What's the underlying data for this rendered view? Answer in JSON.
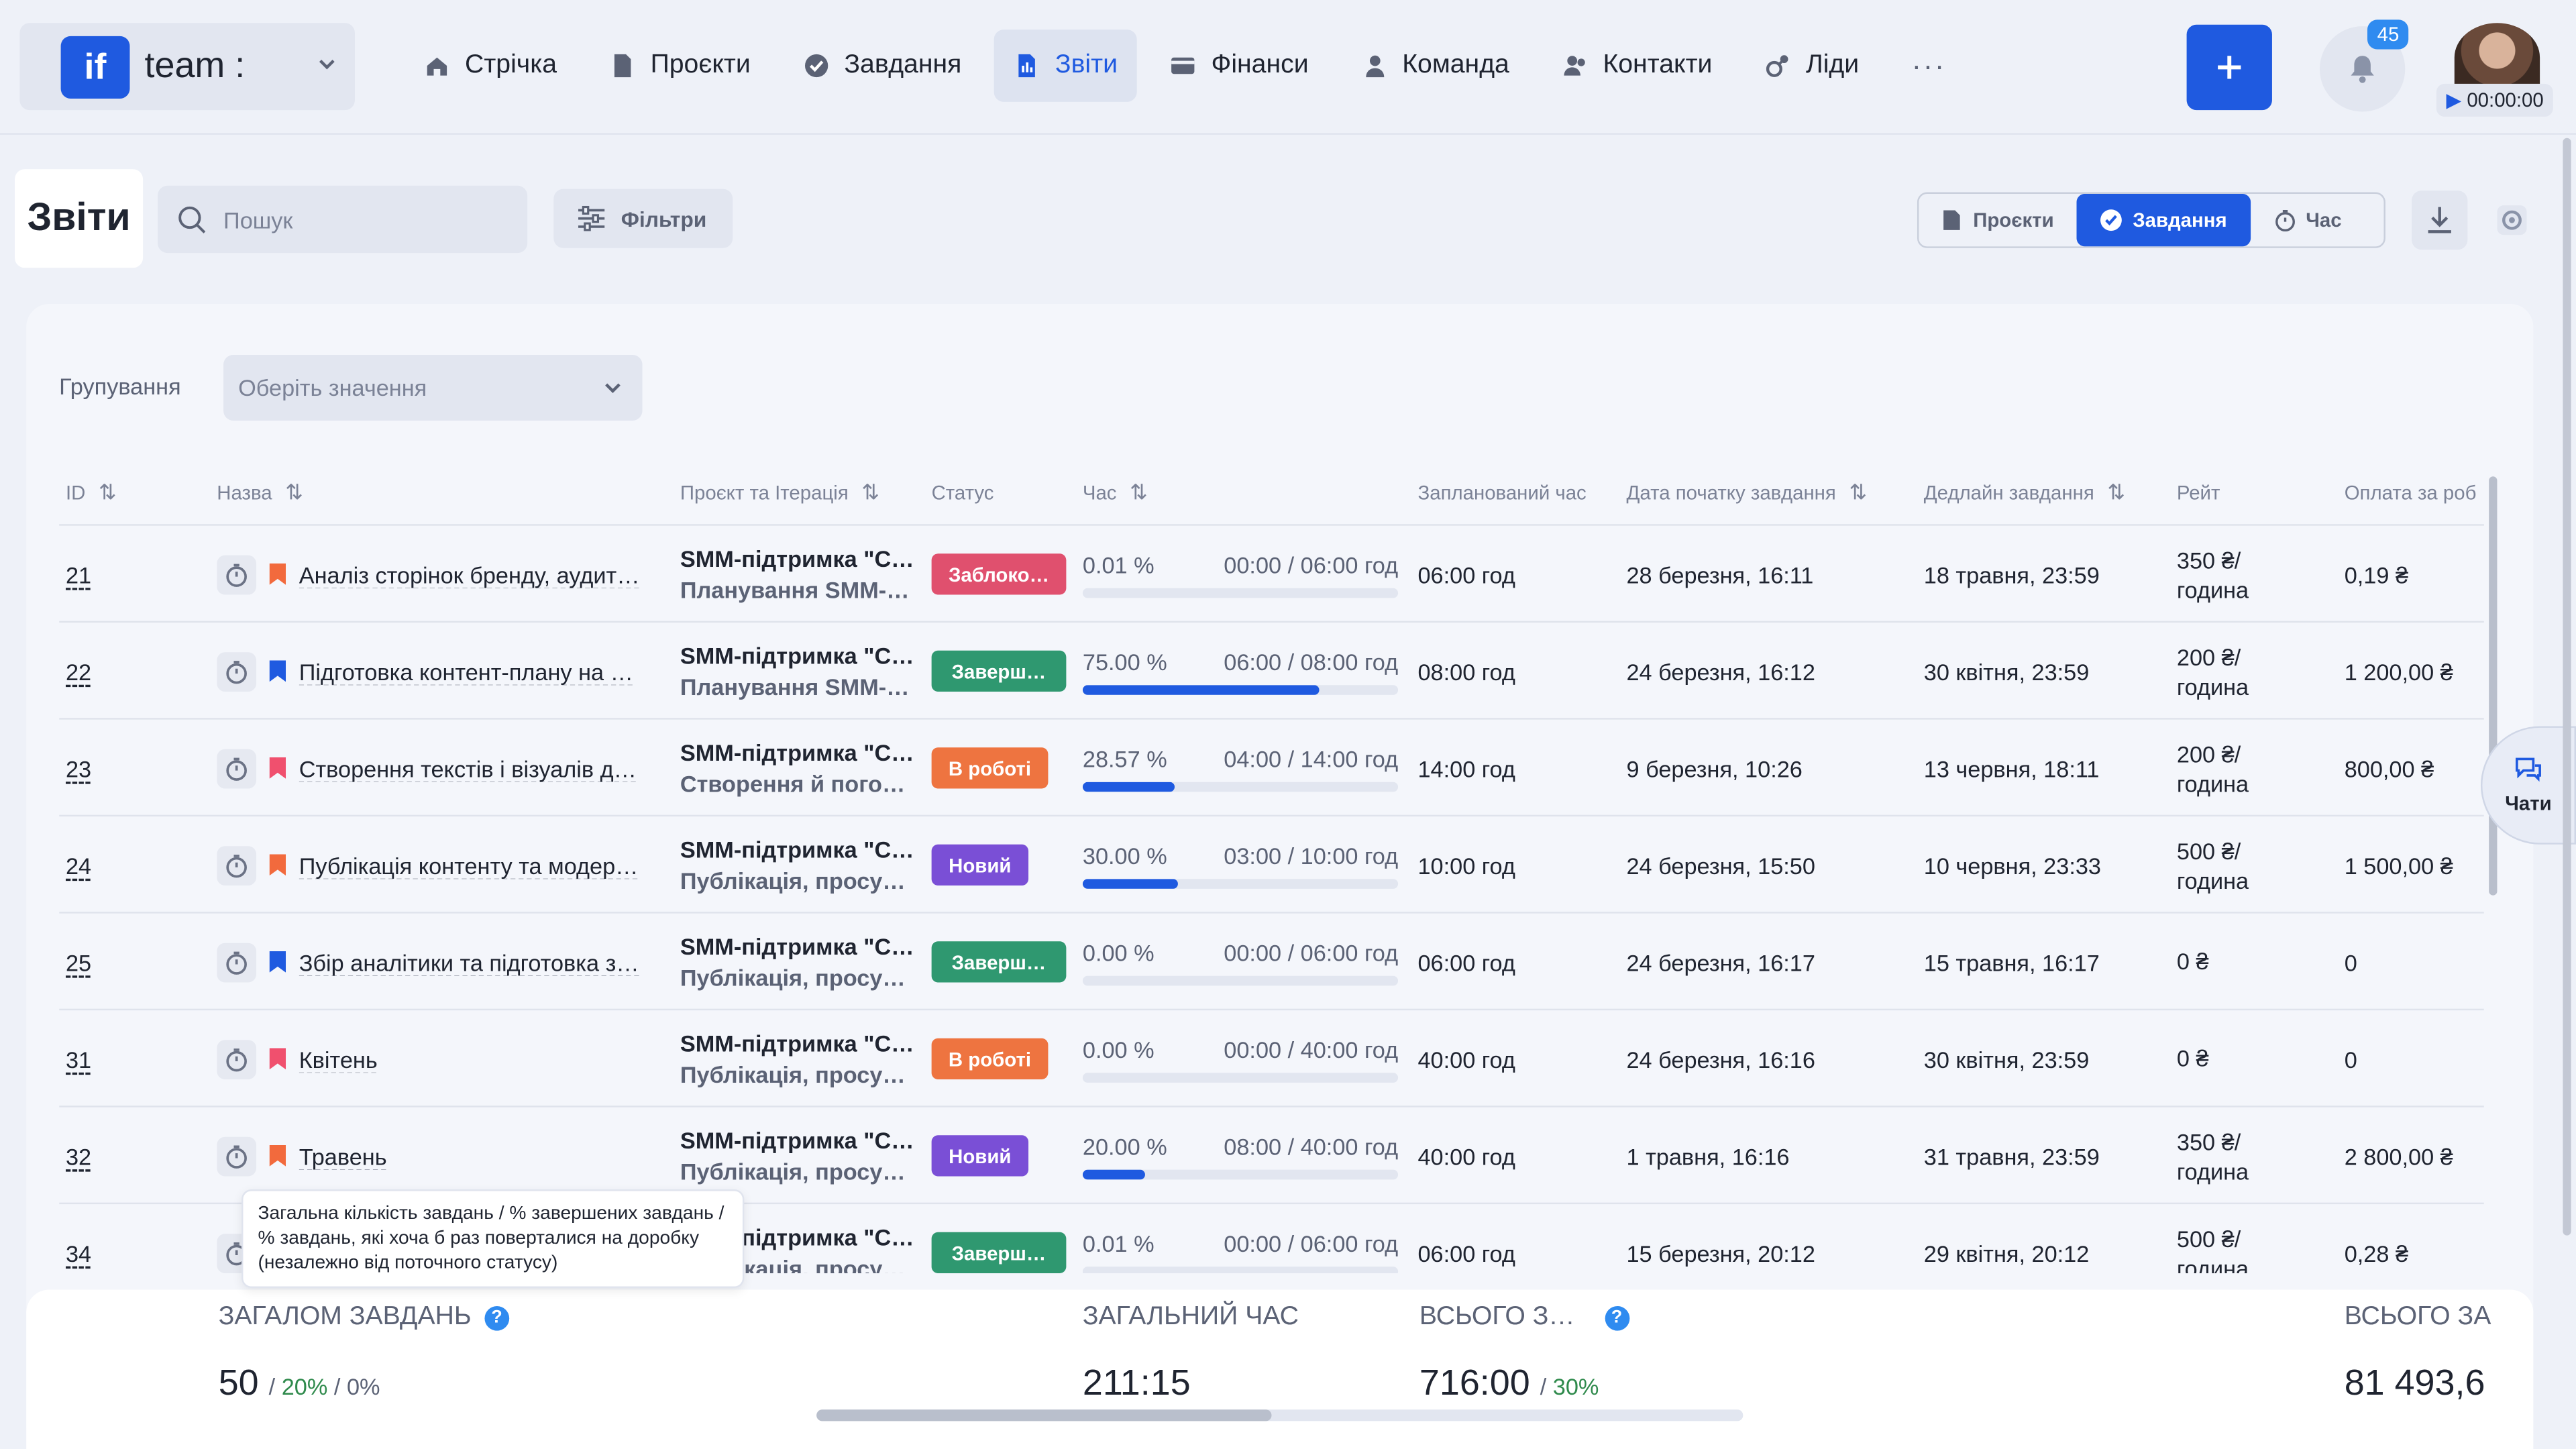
{
  "app": {
    "logo_text": "if",
    "workspace_name": "team :",
    "notifications_count": "45",
    "timer": "00:00:00"
  },
  "nav": [
    {
      "label": "Стрічка",
      "icon": "home-icon"
    },
    {
      "label": "Проєкти",
      "icon": "document-icon"
    },
    {
      "label": "Завдання",
      "icon": "check-circle-icon"
    },
    {
      "label": "Звіти",
      "icon": "report-icon",
      "active": true
    },
    {
      "label": "Фінанси",
      "icon": "wallet-icon"
    },
    {
      "label": "Команда",
      "icon": "user-icon"
    },
    {
      "label": "Контакти",
      "icon": "contacts-icon"
    },
    {
      "label": "Ліди",
      "icon": "leads-icon"
    }
  ],
  "nav_more": "···",
  "page": {
    "title": "Звіти",
    "search_placeholder": "Пошук",
    "filters_label": "Фільтри",
    "view_tabs": [
      {
        "label": "Проєкти",
        "icon": "document-icon"
      },
      {
        "label": "Завдання",
        "icon": "check-circle-icon",
        "active": true
      },
      {
        "label": "Час",
        "icon": "stopwatch-icon"
      }
    ]
  },
  "grouping": {
    "label": "Групування",
    "placeholder": "Оберіть значення"
  },
  "table": {
    "headers": {
      "id": "ID",
      "name": "Назва",
      "project": "Проєкт та Ітерація",
      "status": "Статус",
      "time": "Час",
      "planned": "Запланований час",
      "start": "Дата початку завдання",
      "deadline": "Дедлайн завдання",
      "rate": "Рейт",
      "payment": "Оплата за роб"
    },
    "rows": [
      {
        "id": "21",
        "flag_color": "#f26a3d",
        "name": "Аналіз сторінок бренду, аудит…",
        "project": "SMM-підтримка \"С…",
        "iteration": "Планування SMM-…",
        "status": "Заблоко…",
        "status_color": "#e0506e",
        "percent": "0.01 %",
        "time": "00:00 / 06:00 год",
        "progress": 0.0001,
        "planned": "06:00 год",
        "start": "28 березня, 16:11",
        "deadline": "18 травня, 23:59",
        "rate_line1": "350 ₴/",
        "rate_line2": "година",
        "payment": "0,19 ₴"
      },
      {
        "id": "22",
        "flag_color": "#1f5ae0",
        "name": "Підготовка контент-плану на …",
        "project": "SMM-підтримка \"С…",
        "iteration": "Планування SMM-…",
        "status": "Заверш…",
        "status_color": "#2f9870",
        "percent": "75.00 %",
        "time": "06:00 / 08:00 год",
        "progress": 0.75,
        "planned": "08:00 год",
        "start": "24 березня, 16:12",
        "deadline": "30 квітня, 23:59",
        "rate_line1": "200 ₴/",
        "rate_line2": "година",
        "payment": "1 200,00 ₴"
      },
      {
        "id": "23",
        "flag_color": "#f0506e",
        "name": "Створення текстів і візуалів д…",
        "project": "SMM-підтримка \"С…",
        "iteration": "Створення й пого…",
        "status": "В роботі",
        "status_color": "#ee7440",
        "percent": "28.57 %",
        "time": "04:00 / 14:00 год",
        "progress": 0.2857,
        "planned": "14:00 год",
        "start": "9 березня, 10:26",
        "deadline": "13 червня, 18:11",
        "rate_line1": "200 ₴/",
        "rate_line2": "година",
        "payment": "800,00 ₴"
      },
      {
        "id": "24",
        "flag_color": "#f26a3d",
        "name": "Публікація контенту та модер…",
        "project": "SMM-підтримка \"С…",
        "iteration": "Публікація, просу…",
        "status": "Новий",
        "status_color": "#7a4fd6",
        "percent": "30.00 %",
        "time": "03:00 / 10:00 год",
        "progress": 0.3,
        "planned": "10:00 год",
        "start": "24 березня, 15:50",
        "deadline": "10 червня, 23:33",
        "rate_line1": "500 ₴/",
        "rate_line2": "година",
        "payment": "1 500,00 ₴"
      },
      {
        "id": "25",
        "flag_color": "#1f5ae0",
        "name": "Збір аналітики та підготовка з…",
        "project": "SMM-підтримка \"С…",
        "iteration": "Публікація, просу…",
        "status": "Заверш…",
        "status_color": "#2f9870",
        "percent": "0.00 %",
        "time": "00:00 / 06:00 год",
        "progress": 0,
        "planned": "06:00 год",
        "start": "24 березня, 16:17",
        "deadline": "15 травня, 16:17",
        "rate_line1": "0 ₴",
        "rate_line2": "",
        "payment": "0"
      },
      {
        "id": "31",
        "flag_color": "#f0506e",
        "name": "Квітень",
        "project": "SMM-підтримка \"С…",
        "iteration": "Публікація, просу…",
        "status": "В роботі",
        "status_color": "#ee7440",
        "percent": "0.00 %",
        "time": "00:00 / 40:00 год",
        "progress": 0,
        "planned": "40:00 год",
        "start": "24 березня, 16:16",
        "deadline": "30 квітня, 23:59",
        "rate_line1": "0 ₴",
        "rate_line2": "",
        "payment": "0"
      },
      {
        "id": "32",
        "flag_color": "#f26a3d",
        "name": "Травень",
        "project": "SMM-підтримка \"С…",
        "iteration": "Публікація, просу…",
        "status": "Новий",
        "status_color": "#7a4fd6",
        "percent": "20.00 %",
        "time": "08:00 / 40:00 год",
        "progress": 0.2,
        "planned": "40:00 год",
        "start": "1 травня, 16:16",
        "deadline": "31 травня, 23:59",
        "rate_line1": "350 ₴/",
        "rate_line2": "година",
        "payment": "2 800,00 ₴"
      },
      {
        "id": "34",
        "flag_color": "#1f5ae0",
        "name": "",
        "project": "SMM-підтримка \"С…",
        "iteration": "Публікація, просу…",
        "status": "Заверш…",
        "status_color": "#2f9870",
        "percent": "0.01 %",
        "time": "00:00 / 06:00 год",
        "progress": 0.0001,
        "planned": "06:00 год",
        "start": "15 березня, 20:12",
        "deadline": "29 квітня, 20:12",
        "rate_line1": "500 ₴/",
        "rate_line2": "година",
        "payment": "0,28 ₴"
      }
    ]
  },
  "tooltip": {
    "text": "Загальна кількість завдань / % завершених завдань / % завдань, які хоча б раз поверталися на доробку (незалежно від поточного статусу)"
  },
  "summary": {
    "total_tasks_label": "ЗАГАЛОМ ЗАВДАНЬ",
    "total_tasks_value": "50",
    "total_tasks_done": "20%",
    "total_tasks_returned": "0%",
    "total_time_label": "ЗАГАЛЬНИЙ ЧАС",
    "total_time_value": "211:15",
    "total_planned_label": "ВСЬОГО З…",
    "total_planned_value": "716:00",
    "total_planned_percent": "30%",
    "total_pay_label": "ВСЬОГО ЗА",
    "total_pay_value": "81 493,6"
  },
  "chat": {
    "label": "Чати"
  },
  "colors": {
    "accent": "#1f5ae0",
    "help": "#2f8bf0"
  }
}
